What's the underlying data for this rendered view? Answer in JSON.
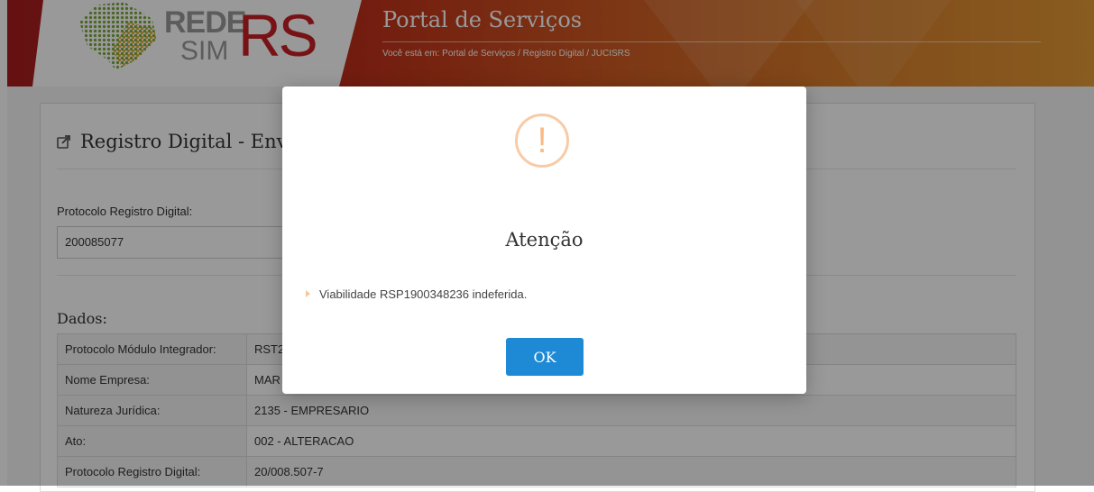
{
  "header": {
    "logo_rede": "REDE",
    "logo_sim": "SIM",
    "logo_rs": "RS",
    "title": "Portal de Serviços",
    "breadcrumb": "Você está em: Portal de Serviços / Registro Digital / JUCISRS"
  },
  "panel": {
    "title": "Registro Digital - Env",
    "protocolo_label": "Protocolo Registro Digital:",
    "protocolo_value": "200085077",
    "dados_title": "Dados:",
    "rows": [
      {
        "key": "Protocolo Módulo Integrador:",
        "value": "RST2"
      },
      {
        "key": "Nome Empresa:",
        "value": "MAR"
      },
      {
        "key": "Natureza Jurídica:",
        "value": "2135 - EMPRESARIO"
      },
      {
        "key": "Ato:",
        "value": "002 - ALTERACAO"
      },
      {
        "key": "Protocolo Registro Digital:",
        "value": "20/008.507-7"
      }
    ]
  },
  "modal": {
    "icon": "exclamation-icon",
    "icon_glyph": "!",
    "title": "Atenção",
    "message": "Viabilidade RSP1900348236 indeferida.",
    "ok_label": "OK",
    "ok_color": "#1e8ad6"
  }
}
